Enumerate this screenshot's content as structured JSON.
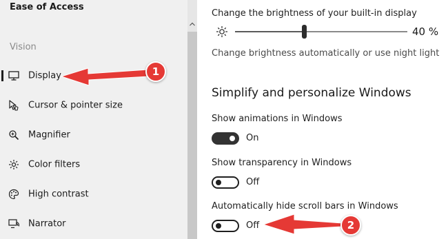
{
  "sidebar": {
    "title": "Ease of Access",
    "section": "Vision",
    "items": [
      {
        "label": "Display",
        "icon": "monitor-icon",
        "selected": true
      },
      {
        "label": "Cursor & pointer size",
        "icon": "cursor-icon"
      },
      {
        "label": "Magnifier",
        "icon": "magnifier-icon"
      },
      {
        "label": "Color filters",
        "icon": "color-filter-icon"
      },
      {
        "label": "High contrast",
        "icon": "palette-icon"
      },
      {
        "label": "Narrator",
        "icon": "narrator-icon"
      }
    ]
  },
  "main": {
    "brightness_label": "Change the brightness of your built-in display",
    "brightness_value": "40 %",
    "brightness_level": 0.4,
    "brightness_link": "Change brightness automatically or use night light",
    "section_heading": "Simplify and personalize Windows",
    "toggles": [
      {
        "label": "Show animations in Windows",
        "state": "On",
        "on": true
      },
      {
        "label": "Show transparency in Windows",
        "state": "Off",
        "on": false
      },
      {
        "label": "Automatically hide scroll bars in Windows",
        "state": "Off",
        "on": false
      }
    ]
  },
  "annotations": [
    "1",
    "2"
  ],
  "colors": {
    "annotation": "#e53935",
    "sidebar_bg": "#f0f0f0"
  }
}
